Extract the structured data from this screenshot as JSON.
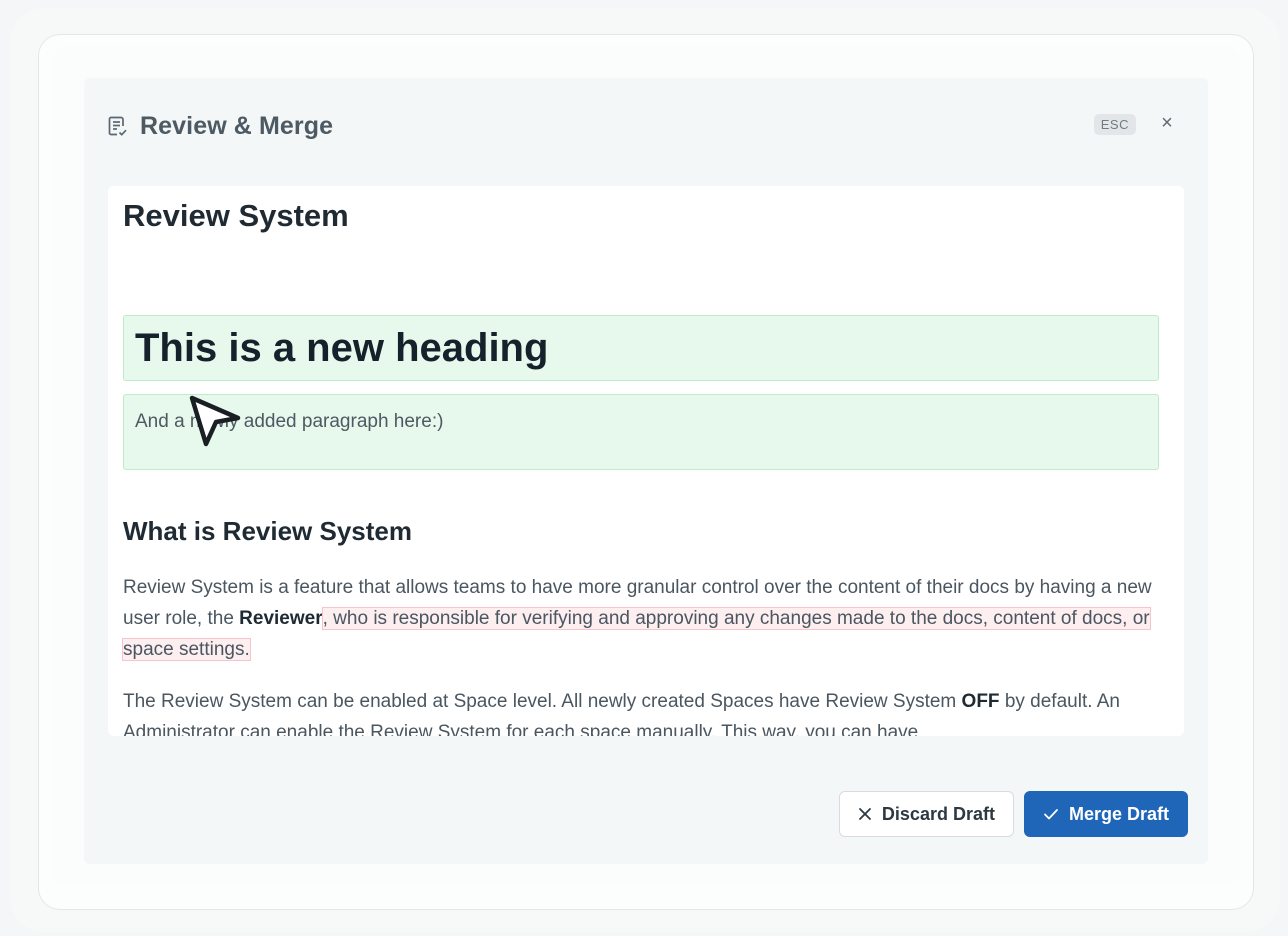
{
  "modal": {
    "title": "Review & Merge",
    "esc_label": "ESC",
    "close_symbol": "×",
    "icon": "document-review-icon"
  },
  "document": {
    "title": "Review System",
    "added_heading": "This is a new heading",
    "added_paragraph": "And a newly added paragraph here:)",
    "section_heading": "What is Review System",
    "para1": {
      "before": "Review System is a feature that allows teams to have more granular control over the content of their docs by having a new user role, the ",
      "bold": "Reviewer",
      "removed": ", who is responsible for verifying and approving any changes made to the docs, content of docs, or space settings."
    },
    "para2": {
      "before": "The Review System can be enabled at Space level. All newly created Spaces have Review System ",
      "bold": "OFF",
      "after": " by default. An Administrator can enable the Review System for each space manually. This way, you can have"
    }
  },
  "actions": {
    "discard_label": "Discard Draft",
    "merge_label": "Merge Draft"
  },
  "colors": {
    "added_bg": "#e7f8ec",
    "removed_bg": "#fdeef0",
    "primary": "#1f65b8"
  }
}
